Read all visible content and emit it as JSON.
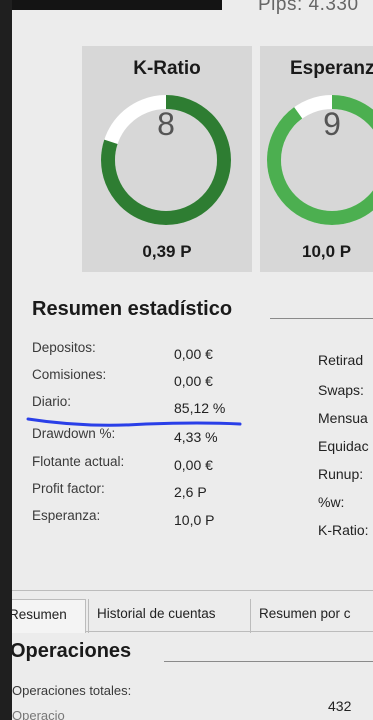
{
  "header": {
    "pips_text": "Pips: 4.330"
  },
  "cards": [
    {
      "title": "K-Ratio",
      "gauge_value": "8",
      "footer": "0,39 P",
      "color": "#2e7d32",
      "fill_fraction": 0.8
    },
    {
      "title": "Esperanza",
      "gauge_value": "9",
      "footer": "10,0 P",
      "color": "#4caf50",
      "fill_fraction": 0.9
    }
  ],
  "summary": {
    "title": "Resumen estadístico",
    "rows": [
      {
        "label": "Depositos:",
        "value": "0,00 €"
      },
      {
        "label": "Comisiones:",
        "value": "0,00 €"
      },
      {
        "label": "Diario:",
        "value": "85,12 %"
      },
      {
        "label": "Drawdown %:",
        "value": "4,33 %"
      },
      {
        "label": "Flotante actual:",
        "value": "0,00 €"
      },
      {
        "label": "Profit factor:",
        "value": "2,6 P"
      },
      {
        "label": "Esperanza:",
        "value": "10,0 P"
      }
    ],
    "right_labels": [
      "Retirad",
      "Swaps:",
      "Mensua",
      "Equidac",
      "Runup:",
      "%w:",
      "K-Ratio:"
    ]
  },
  "tabs": [
    {
      "label": "Resumen",
      "active": true
    },
    {
      "label": "Historial de cuentas",
      "active": false
    },
    {
      "label": "Resumen por c",
      "active": false
    }
  ],
  "operations": {
    "title": "Operaciones",
    "rows": [
      {
        "label": "Operaciones totales:",
        "value": "432"
      }
    ],
    "cut_label": "Operacio"
  },
  "colors": {
    "annotation": "#2a3fe8",
    "gauge_track": "#ffffff"
  }
}
